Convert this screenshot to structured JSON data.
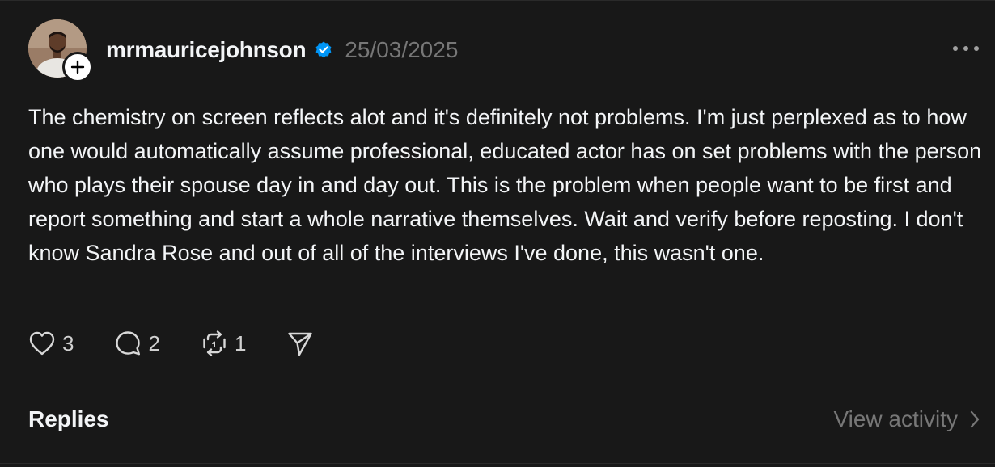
{
  "post": {
    "username": "mrmauricejohnson",
    "date": "25/03/2025",
    "verified_icon": "verified-badge-icon",
    "text": "The chemistry on screen reflects alot and it's definitely not problems. I'm just perplexed as to how one would automatically assume professional, educated actor has on set problems with the person who plays their spouse day in and day out. This is the problem when people want to be first and report something and start a whole narrative themselves. Wait and verify before reposting. I don't know Sandra Rose and out of all of the interviews I've done, this wasn't one.",
    "actions": {
      "likes": "3",
      "comments": "2",
      "reposts": "1"
    }
  },
  "footer": {
    "replies_label": "Replies",
    "view_activity_label": "View activity"
  },
  "colors": {
    "background": "#181818",
    "text": "#f3f5f7",
    "muted": "#777777",
    "verified": "#0095f6"
  }
}
